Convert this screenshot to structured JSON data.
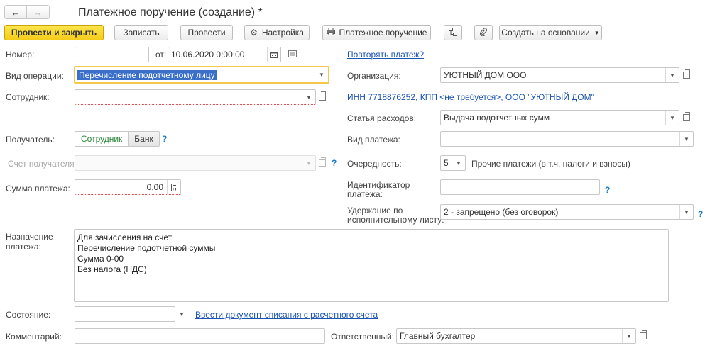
{
  "window": {
    "title": "Платежное поручение (создание) *"
  },
  "nav": {
    "back_icon": "←",
    "forward_icon": "→"
  },
  "toolbar": {
    "post_close": "Провести и закрыть",
    "save": "Записать",
    "post": "Провести",
    "settings": "Настройка",
    "print": "Платежное поручение",
    "create_based": "Создать на основании"
  },
  "form": {
    "number_label": "Номер:",
    "number_value": "",
    "date_label": "от:",
    "date_value": "10.06.2020  0:00:00",
    "repeat_link": "Повторять платеж?",
    "operation_label": "Вид операции:",
    "operation_value": "Перечисление подотчетному лицу",
    "org_label": "Организация:",
    "org_value": "УЮТНЫЙ ДОМ ООО",
    "employee_label": "Сотрудник:",
    "employee_value": "",
    "inn_link": "ИНН 7718876252, КПП <не требуется>, ООО \"УЮТНЫЙ ДОМ\"",
    "expense_label": "Статья расходов:",
    "expense_value": "Выдача подотчетных сумм",
    "recipient_label": "Получатель:",
    "recipient_options": [
      "Сотрудник",
      "Банк"
    ],
    "payment_type_label": "Вид платежа:",
    "payment_type_value": "",
    "recipient_account_label": "Счет получателя:",
    "recipient_account_value": "",
    "priority_label": "Очередность:",
    "priority_value": "5",
    "priority_desc": "Прочие платежи (в т.ч. налоги и взносы)",
    "amount_label": "Сумма платежа:",
    "amount_value": "0,00",
    "payment_id_label_1": "Идентификатор",
    "payment_id_label_2": "платежа:",
    "payment_id_value": "",
    "withholding_label_1": "Удержание по",
    "withholding_label_2": "исполнительному листу:",
    "withholding_value": "2 - запрещено (без оговорок)",
    "purpose_label_1": "Назначение",
    "purpose_label_2": "платежа:",
    "purpose_lines": [
      "Для зачисления на счет",
      "Перечисление подотчетной суммы",
      "Сумма 0-00",
      "Без налога (НДС)"
    ],
    "state_label": "Состояние:",
    "state_value": "",
    "writeoff_link": "Ввести документ списания с расчетного счета",
    "comment_label": "Комментарий:",
    "comment_value": "",
    "responsible_label": "Ответственный:",
    "responsible_value": "Главный бухгалтер",
    "help_mark": "?"
  },
  "colors": {
    "primary_button": "#f4cc1a",
    "link": "#1b55b3",
    "selection": "#3a6fc9",
    "focus_border": "#f4c84a",
    "required_underline": "#d04040"
  }
}
